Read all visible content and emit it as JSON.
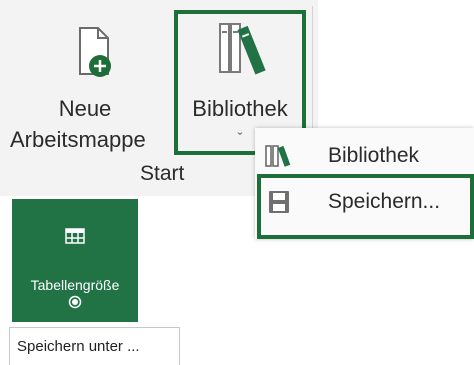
{
  "ribbon": {
    "new_workbook": {
      "line1": "Neue",
      "line2": "Arbeitsmappe",
      "icon": "new-document-icon"
    },
    "library": {
      "label": "Bibliothek",
      "chevron": "ˇ",
      "icon": "library-books-icon"
    },
    "group_label": "Start"
  },
  "dropdown": {
    "items": [
      {
        "label": "Bibliothek",
        "icon": "library-books-icon"
      },
      {
        "label": "Speichern...",
        "icon": "save-disk-icon"
      }
    ]
  },
  "table_size": {
    "label": "Tabellengröße",
    "icon": "table-grid-icon"
  },
  "save_as": {
    "label": "Speichern unter ..."
  },
  "colors": {
    "accent": "#217346",
    "highlight_border": "#1e6e3a",
    "ribbon_bg": "#f3f3f3"
  }
}
